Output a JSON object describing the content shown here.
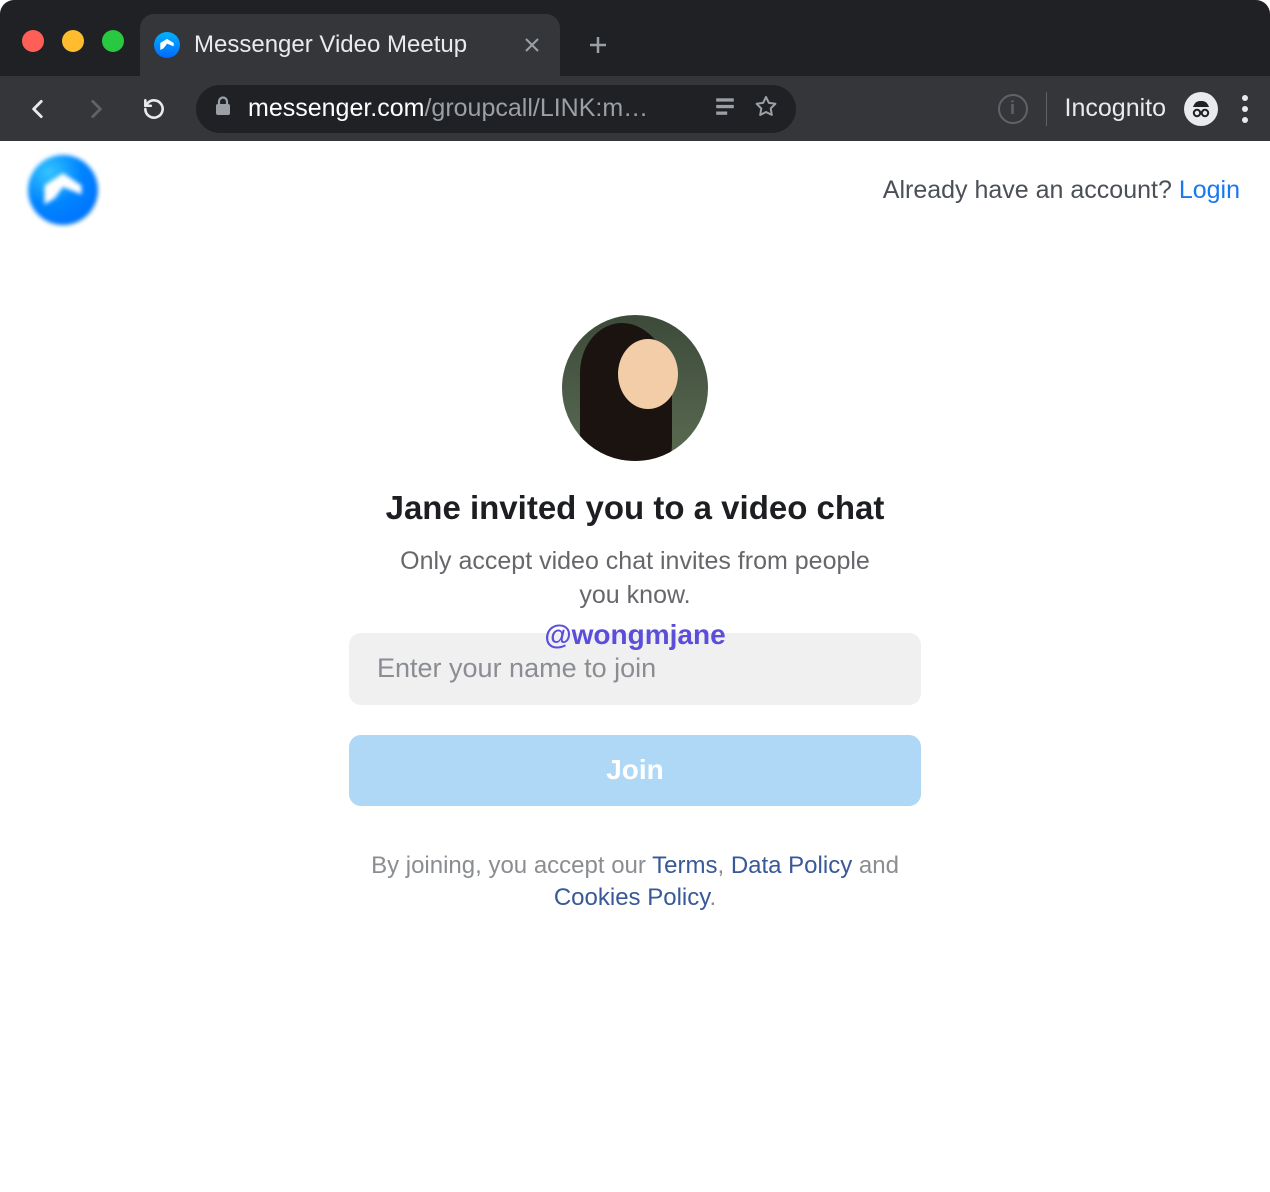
{
  "browser": {
    "tab_title": "Messenger Video Meetup",
    "url_host": "messenger.com",
    "url_path": "/groupcall/LINK:m…",
    "incognito_label": "Incognito"
  },
  "header": {
    "account_prompt": "Already have an account? ",
    "login_link": "Login"
  },
  "invite": {
    "title": "Jane invited you to a video chat",
    "subtitle": "Only accept video chat invites from people you know.",
    "watermark": "@wongmjane",
    "name_placeholder": "Enter your name to join",
    "join_label": "Join"
  },
  "legal": {
    "prefix": "By joining, you accept our ",
    "terms": "Terms",
    "sep1": ", ",
    "data_policy": "Data Policy",
    "sep2": " and ",
    "cookies_policy": "Cookies Policy",
    "suffix": "."
  }
}
